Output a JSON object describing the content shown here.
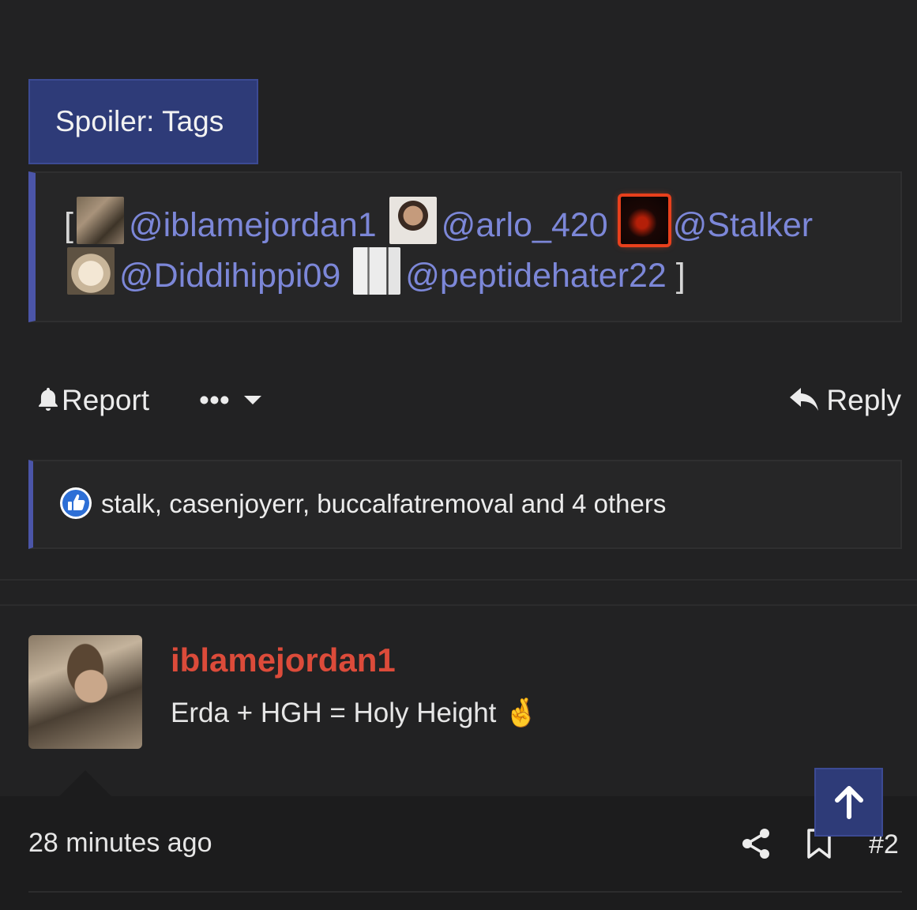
{
  "spoiler": {
    "button_label": "Spoiler: Tags",
    "open_bracket": "[",
    "close_bracket": "]",
    "mentions": [
      {
        "handle": "@iblamejordan1"
      },
      {
        "handle": "@arlo_420"
      },
      {
        "handle": "@Stalker"
      },
      {
        "handle": "@Diddihippi09"
      },
      {
        "handle": "@peptidehater22"
      }
    ]
  },
  "actions": {
    "report_label": "Report",
    "more_label": "•••",
    "reply_label": "Reply"
  },
  "reactions": {
    "summary": "stalk, casenjoyerr, buccalfatremoval and 4 others"
  },
  "comment": {
    "username": "iblamejordan1",
    "text": "Erda + HGH = Holy Height 🤞"
  },
  "footer": {
    "timestamp": "28 minutes ago",
    "post_number": "#2"
  },
  "colors": {
    "background": "#222223",
    "accent_blue": "#2e3b78",
    "mention_blue": "#7c87d8",
    "quote_bar": "#4b55a8",
    "username_red": "#dc4b3a"
  }
}
